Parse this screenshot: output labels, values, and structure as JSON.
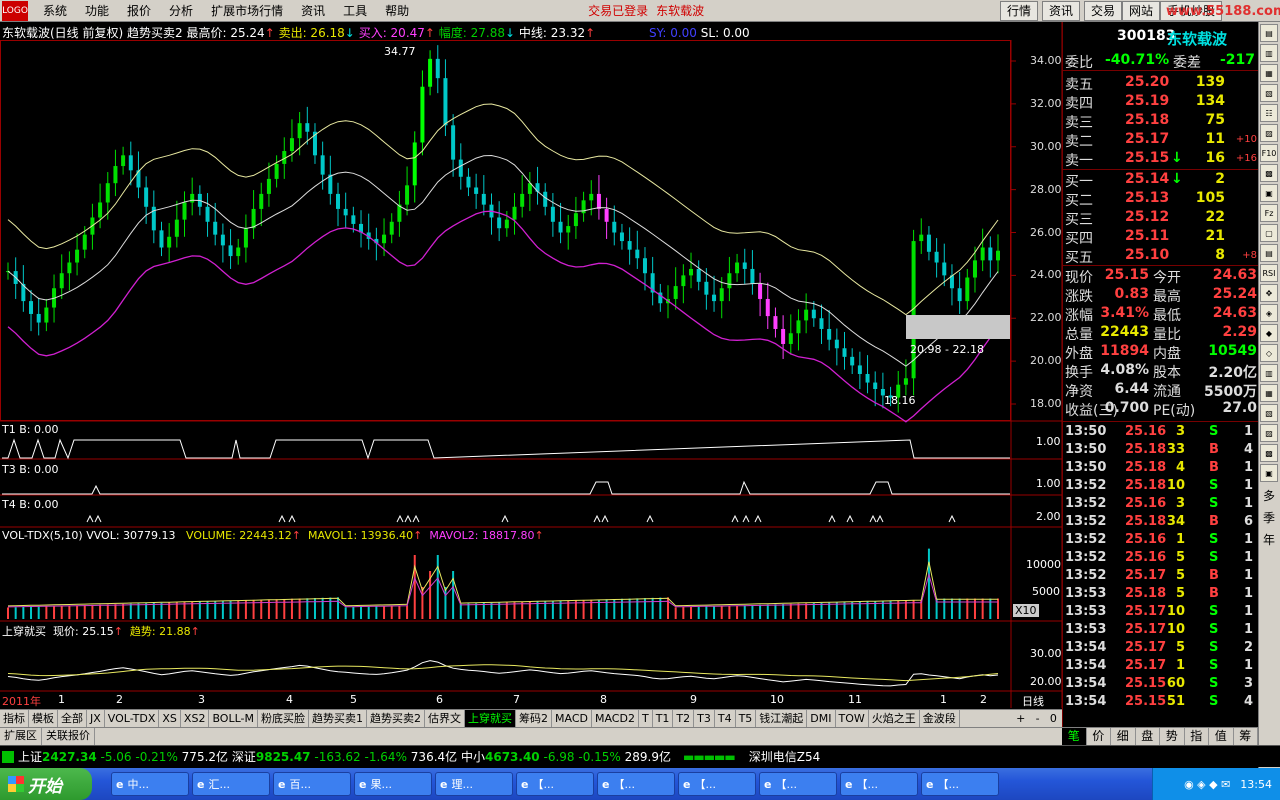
{
  "menu": {
    "items": [
      "系统",
      "功能",
      "报价",
      "分析",
      "扩展市场行情",
      "资讯",
      "工具",
      "帮助"
    ],
    "status1": "交易已登录",
    "status2": "东软载波",
    "buttons": [
      "行情",
      "资讯",
      "交易",
      "网站",
      "手机炒股"
    ],
    "watermark": "www.55188.com"
  },
  "chart_header": {
    "name": "东软载波(日线 前复权) 趋势买卖2",
    "high": "最高价: 25.24",
    "sell": "卖出: 26.18",
    "buy": "买入: 20.47",
    "amp": "幅度: 27.88",
    "mid": "中线: 23.32",
    "sy": "SY: 0.00",
    "sl": "SL: 0.00"
  },
  "price_axis": [
    "34.00",
    "32.00",
    "30.00",
    "28.00",
    "26.00",
    "24.00",
    "22.00",
    "20.00",
    "18.00"
  ],
  "annotations": {
    "peak": "34.77",
    "low": "18.16",
    "range": "20.98 - 22.18"
  },
  "panels": {
    "t1": "T1  B: 0.00",
    "t3": "T3  B: 0.00",
    "t4": "T4  B: 0.00",
    "t1axis": "1.00",
    "t3axis": "1.00",
    "t4axis": "2.00"
  },
  "vol": {
    "name": "VOL-TDX(5,10)",
    "vvol": "VVOL: 30779.13",
    "volume": "VOLUME: 22443.12",
    "mavol1": "MAVOL1: 13936.40",
    "mavol2": "MAVOL2: 18817.80",
    "axis": [
      "10000",
      "5000"
    ],
    "unit": "X10"
  },
  "cross": {
    "name": "上穿就买",
    "price": "现价: 25.15",
    "trend": "趋势: 21.88",
    "axis": [
      "30.00",
      "20.00"
    ]
  },
  "time_axis": {
    "year": "2011年",
    "months": [
      "1",
      "2",
      "3",
      "4",
      "5",
      "6",
      "7",
      "8",
      "9",
      "10",
      "11",
      "1",
      "2"
    ],
    "period": "日线"
  },
  "chart_data": {
    "type": "candlestick",
    "title": "东软载波(日线 前复权)",
    "ylim": [
      17.5,
      35
    ],
    "peak": 34.77,
    "trough": 18.16,
    "close": [
      24.2,
      23.6,
      22.8,
      22.2,
      21.8,
      22.5,
      23.4,
      24.1,
      24.6,
      25.2,
      25.9,
      26.7,
      27.4,
      28.3,
      29.1,
      29.6,
      28.9,
      28.1,
      27.2,
      26.1,
      25.3,
      25.8,
      26.6,
      27.4,
      27.8,
      27.2,
      26.5,
      25.9,
      25.4,
      24.9,
      25.3,
      26.2,
      27.1,
      27.8,
      28.5,
      29.2,
      29.8,
      30.4,
      31.1,
      30.7,
      29.6,
      28.7,
      27.8,
      27.1,
      26.8,
      26.4,
      26.0,
      25.7,
      25.5,
      25.9,
      26.5,
      27.3,
      28.2,
      30.2,
      32.8,
      34.1,
      33.2,
      31.0,
      29.4,
      28.6,
      28.1,
      27.8,
      27.3,
      26.7,
      26.2,
      26.6,
      27.2,
      27.8,
      28.3,
      27.9,
      27.2,
      26.5,
      26.0,
      26.3,
      26.9,
      27.5,
      27.8,
      27.1,
      26.5,
      26.0,
      25.6,
      25.2,
      24.8,
      24.1,
      23.2,
      22.7,
      22.9,
      23.5,
      24.0,
      24.3,
      23.7,
      23.1,
      22.8,
      23.4,
      24.1,
      24.6,
      24.3,
      23.6,
      22.9,
      22.1,
      21.5,
      20.8,
      21.3,
      21.9,
      22.4,
      22.0,
      21.5,
      21.0,
      20.6,
      20.2,
      19.8,
      19.4,
      19.0,
      18.7,
      18.4,
      18.3,
      18.9,
      19.2,
      25.6,
      25.9,
      25.1,
      24.6,
      24.0,
      23.4,
      22.8,
      23.9,
      24.7,
      25.3,
      24.7,
      25.15
    ]
  },
  "quote": {
    "code": "300183",
    "name": "东软载波",
    "wb": {
      "label": "委比",
      "val": "-40.71%",
      "diff_label": "委差",
      "diff": "-217"
    },
    "asks": [
      {
        "l": "卖五",
        "p": "25.20",
        "v": "139",
        "c": ""
      },
      {
        "l": "卖四",
        "p": "25.19",
        "v": "134",
        "c": ""
      },
      {
        "l": "卖三",
        "p": "25.18",
        "v": "75",
        "c": ""
      },
      {
        "l": "卖二",
        "p": "25.17",
        "v": "11",
        "c": "+10"
      },
      {
        "l": "卖一",
        "p": "25.15",
        "v": "16",
        "c": "+16"
      }
    ],
    "bids": [
      {
        "l": "买一",
        "p": "25.14",
        "v": "2",
        "c": ""
      },
      {
        "l": "买二",
        "p": "25.13",
        "v": "105",
        "c": ""
      },
      {
        "l": "买三",
        "p": "25.12",
        "v": "22",
        "c": ""
      },
      {
        "l": "买四",
        "p": "25.11",
        "v": "21",
        "c": ""
      },
      {
        "l": "买五",
        "p": "25.10",
        "v": "8",
        "c": "+8"
      }
    ],
    "stats": [
      [
        "现价",
        "25.15",
        "今开",
        "24.63"
      ],
      [
        "涨跌",
        "0.83",
        "最高",
        "25.24"
      ],
      [
        "涨幅",
        "3.41%",
        "最低",
        "24.63"
      ],
      [
        "总量",
        "22443",
        "量比",
        "2.29"
      ],
      [
        "外盘",
        "11894",
        "内盘",
        "10549"
      ],
      [
        "换手",
        "4.08%",
        "股本",
        "2.20亿"
      ],
      [
        "净资",
        "6.44",
        "流通",
        "5500万"
      ],
      [
        "收益(三)",
        "0.700",
        "PE(动)",
        "27.0"
      ]
    ]
  },
  "ticks": [
    [
      "13:50",
      "25.16",
      "3",
      "S",
      "1"
    ],
    [
      "13:50",
      "25.18",
      "33",
      "B",
      "4"
    ],
    [
      "13:50",
      "25.18",
      "4",
      "B",
      "1"
    ],
    [
      "13:52",
      "25.18",
      "10",
      "S",
      "1"
    ],
    [
      "13:52",
      "25.16",
      "3",
      "S",
      "1"
    ],
    [
      "13:52",
      "25.18",
      "34",
      "B",
      "6"
    ],
    [
      "13:52",
      "25.16",
      "1",
      "S",
      "1"
    ],
    [
      "13:52",
      "25.16",
      "5",
      "S",
      "1"
    ],
    [
      "13:52",
      "25.17",
      "5",
      "B",
      "1"
    ],
    [
      "13:53",
      "25.18",
      "5",
      "B",
      "1"
    ],
    [
      "13:53",
      "25.17",
      "10",
      "S",
      "1"
    ],
    [
      "13:53",
      "25.17",
      "10",
      "S",
      "1"
    ],
    [
      "13:54",
      "25.17",
      "5",
      "S",
      "2"
    ],
    [
      "13:54",
      "25.17",
      "1",
      "S",
      "1"
    ],
    [
      "13:54",
      "25.15",
      "60",
      "S",
      "3"
    ],
    [
      "13:54",
      "25.15",
      "51",
      "S",
      "4"
    ]
  ],
  "indicator_tabs": [
    "指标",
    "模板",
    "全部",
    "JX",
    "VOL-TDX",
    "XS",
    "XS2",
    "BOLL-M",
    "粉底买脸",
    "趋势买卖1",
    "趋势买卖2",
    "估界文",
    "上穿就买",
    "筹码2",
    "MACD",
    "MACD2",
    "T",
    "T1",
    "T2",
    "T3",
    "T4",
    "T5",
    "钱江潮起",
    "DMI",
    "TOW",
    "火焰之王",
    "金波段"
  ],
  "extra_tabs": [
    "扩展区",
    "关联报价"
  ],
  "right_tabs": [
    "笔",
    "价",
    "细",
    "盘",
    "势",
    "指",
    "值",
    "筹"
  ],
  "side_tabs": [
    "多",
    "季",
    "年"
  ],
  "status": {
    "sh": "上证",
    "sh_val": "2427.34",
    "sh_chg": "-5.06",
    "sh_pct": "-0.21%",
    "sh_amt": "775.2亿",
    "sz": "深证",
    "sz_val": "9825.47",
    "sz_chg": "-163.62",
    "sz_pct": "-1.64%",
    "sz_amt": "736.4亿",
    "zx": "中小",
    "zx_val": "4673.40",
    "zx_chg": "-6.98",
    "zx_pct": "-0.15%",
    "zx_amt": "289.9亿",
    "server": "深圳电信Z54"
  },
  "taskbar": {
    "start": "开始",
    "items": [
      "中...",
      "汇...",
      "百...",
      "果...",
      "理...",
      "【...",
      "【...",
      "【...",
      "【...",
      "【...",
      "【..."
    ],
    "clock": "13:54"
  }
}
